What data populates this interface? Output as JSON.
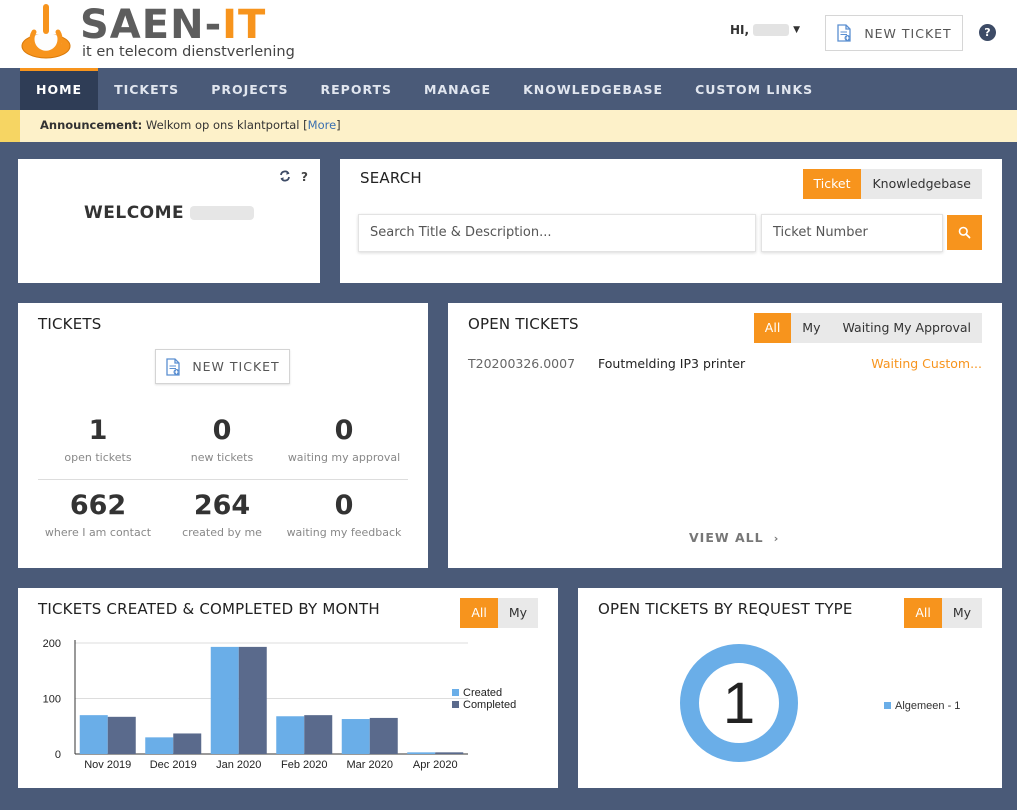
{
  "brand": {
    "name_part1": "SAEN-",
    "name_part2": "IT",
    "tagline": "it en telecom dienstverlening",
    "colors": {
      "accent": "#f7941d",
      "nav": "#4a5a78",
      "nav_active": "#2f3d56",
      "link": "#3a6fb0"
    }
  },
  "header": {
    "greeting": "HI,",
    "new_ticket_label": "NEW TICKET",
    "help_label": "?"
  },
  "nav": {
    "items": [
      {
        "label": "HOME",
        "active": true
      },
      {
        "label": "TICKETS",
        "active": false
      },
      {
        "label": "PROJECTS",
        "active": false
      },
      {
        "label": "REPORTS",
        "active": false
      },
      {
        "label": "MANAGE",
        "active": false
      },
      {
        "label": "KNOWLEDGEBASE",
        "active": false
      },
      {
        "label": "CUSTOM LINKS",
        "active": false
      }
    ]
  },
  "announcement": {
    "label": "Announcement:",
    "text": "Welkom op ons klantportal",
    "more_open": "[",
    "more": "More",
    "more_close": "]"
  },
  "welcome": {
    "title": "WELCOME",
    "help_label": "?"
  },
  "search": {
    "title": "SEARCH",
    "tabs": [
      "Ticket",
      "Knowledgebase"
    ],
    "title_placeholder": "Search Title & Description...",
    "number_placeholder": "Ticket Number"
  },
  "tickets": {
    "title": "TICKETS",
    "new_ticket_label": "NEW TICKET",
    "stats": [
      {
        "value": "1",
        "label": "open tickets"
      },
      {
        "value": "0",
        "label": "new tickets"
      },
      {
        "value": "0",
        "label": "waiting my approval"
      },
      {
        "value": "662",
        "label": "where I am contact"
      },
      {
        "value": "264",
        "label": "created by me"
      },
      {
        "value": "0",
        "label": "waiting my feedback"
      }
    ]
  },
  "open_tickets": {
    "title": "OPEN TICKETS",
    "filters": [
      "All",
      "My",
      "Waiting My Approval"
    ],
    "rows": [
      {
        "id": "T20200326.0007",
        "title": "Foutmelding IP3 printer",
        "status": "Waiting Custom..."
      }
    ],
    "view_all": "VIEW ALL"
  },
  "by_month": {
    "title": "TICKETS CREATED & COMPLETED BY MONTH",
    "filters": [
      "All",
      "My"
    ]
  },
  "by_type": {
    "title": "OPEN TICKETS BY REQUEST TYPE",
    "filters": [
      "All",
      "My"
    ],
    "center_value": "1",
    "legend": "Algemeen - 1",
    "color": "#6aaee8"
  },
  "chart_data": {
    "type": "bar",
    "categories": [
      "Nov 2019",
      "Dec 2019",
      "Jan 2020",
      "Feb 2020",
      "Mar 2020",
      "Apr 2020"
    ],
    "series": [
      {
        "name": "Created",
        "values": [
          70,
          30,
          193,
          68,
          63,
          3
        ],
        "color": "#6aaee8"
      },
      {
        "name": "Completed",
        "values": [
          67,
          37,
          193,
          70,
          65,
          3
        ],
        "color": "#5a6a8c"
      }
    ],
    "yticks": [
      0,
      100,
      200
    ],
    "ylim": [
      0,
      210
    ],
    "grid": true,
    "legend": "right"
  }
}
